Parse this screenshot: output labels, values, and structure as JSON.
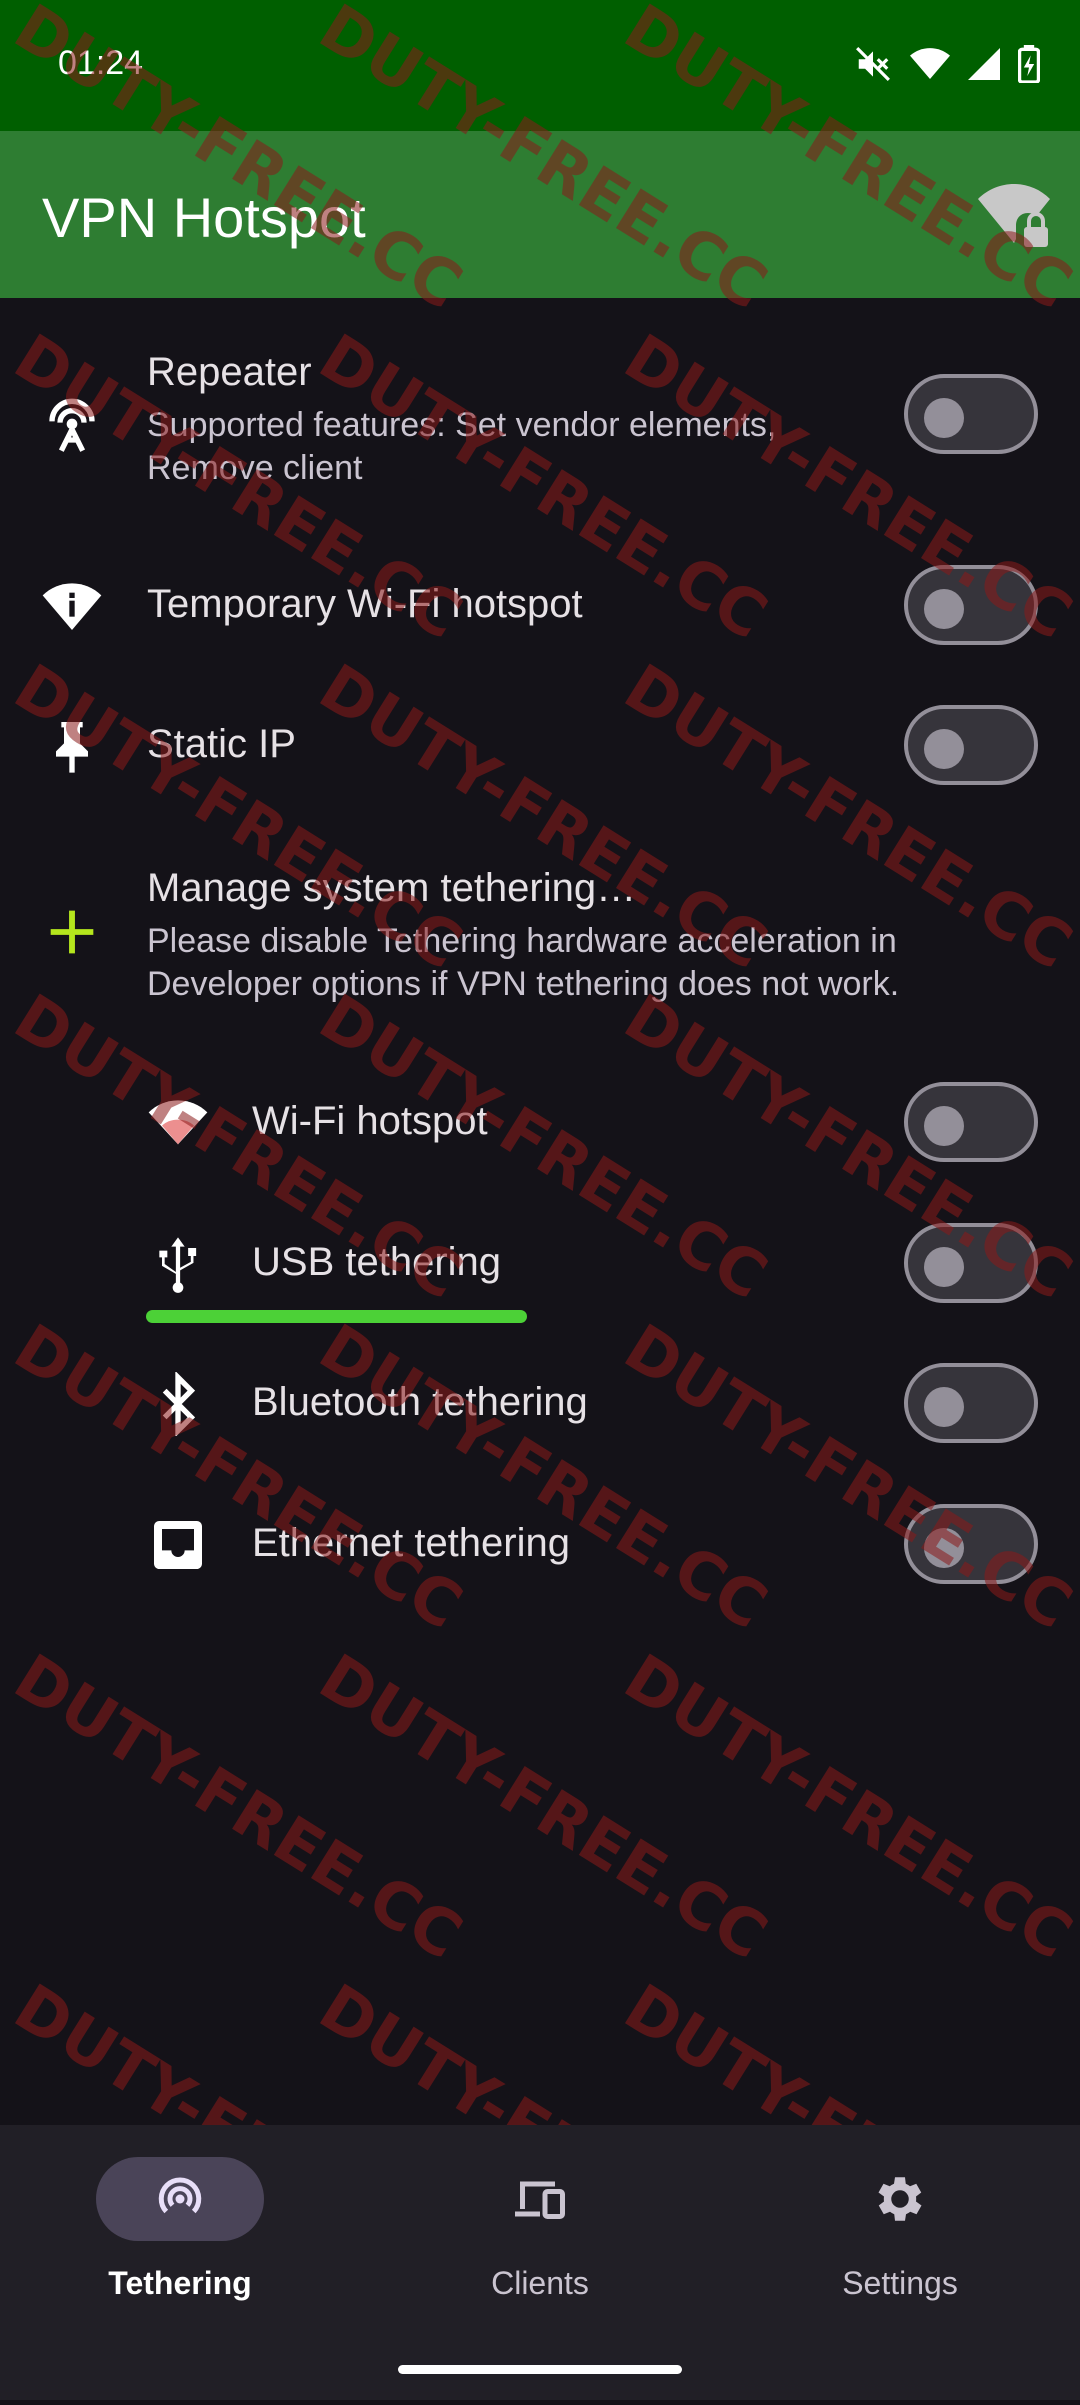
{
  "status_bar": {
    "time": "01:24",
    "icons": [
      "mute-icon",
      "wifi-icon",
      "signal-icon",
      "battery-icon"
    ]
  },
  "app_bar": {
    "title": "VPN Hotspot",
    "icon": "wifi-lock-icon",
    "color": "#2e7d32"
  },
  "items": [
    {
      "id": "repeater",
      "icon": "repeater-icon",
      "title": "Repeater",
      "summary": "Supported features: Set vendor elements, Remove client",
      "enabled": false
    },
    {
      "id": "temp-hotspot",
      "icon": "wifi-icon",
      "title": "Temporary Wi-Fi hotspot",
      "enabled": false
    },
    {
      "id": "static-ip",
      "icon": "pin-icon",
      "title": "Static IP",
      "enabled": false
    },
    {
      "id": "manage-tethering",
      "icon": "plus-icon",
      "title": "Manage system tethering…",
      "summary": "Please disable Tethering hardware acceleration in Developer options if VPN tethering does not work."
    },
    {
      "id": "wifi-hotspot",
      "icon": "wifi-icon",
      "title": "Wi-Fi hotspot",
      "enabled": false
    },
    {
      "id": "usb-tethering",
      "icon": "usb-icon",
      "title": "USB tethering",
      "enabled": false
    },
    {
      "id": "bluetooth-tethering",
      "icon": "bluetooth-icon",
      "title": "Bluetooth tethering",
      "enabled": false
    },
    {
      "id": "ethernet-tethering",
      "icon": "ethernet-icon",
      "title": "Ethernet tethering",
      "enabled": false
    }
  ],
  "bottom_nav": {
    "items": [
      {
        "label": "Tethering",
        "icon": "tethering-icon",
        "active": true
      },
      {
        "label": "Clients",
        "icon": "devices-icon",
        "active": false
      },
      {
        "label": "Settings",
        "icon": "gear-icon",
        "active": false
      }
    ]
  },
  "watermark": "DUTY-FREE.CC",
  "colors": {
    "status_bar": "#005f00",
    "background": "#141218",
    "accent": "#4cd137",
    "watermark": "#8b1a1a"
  }
}
